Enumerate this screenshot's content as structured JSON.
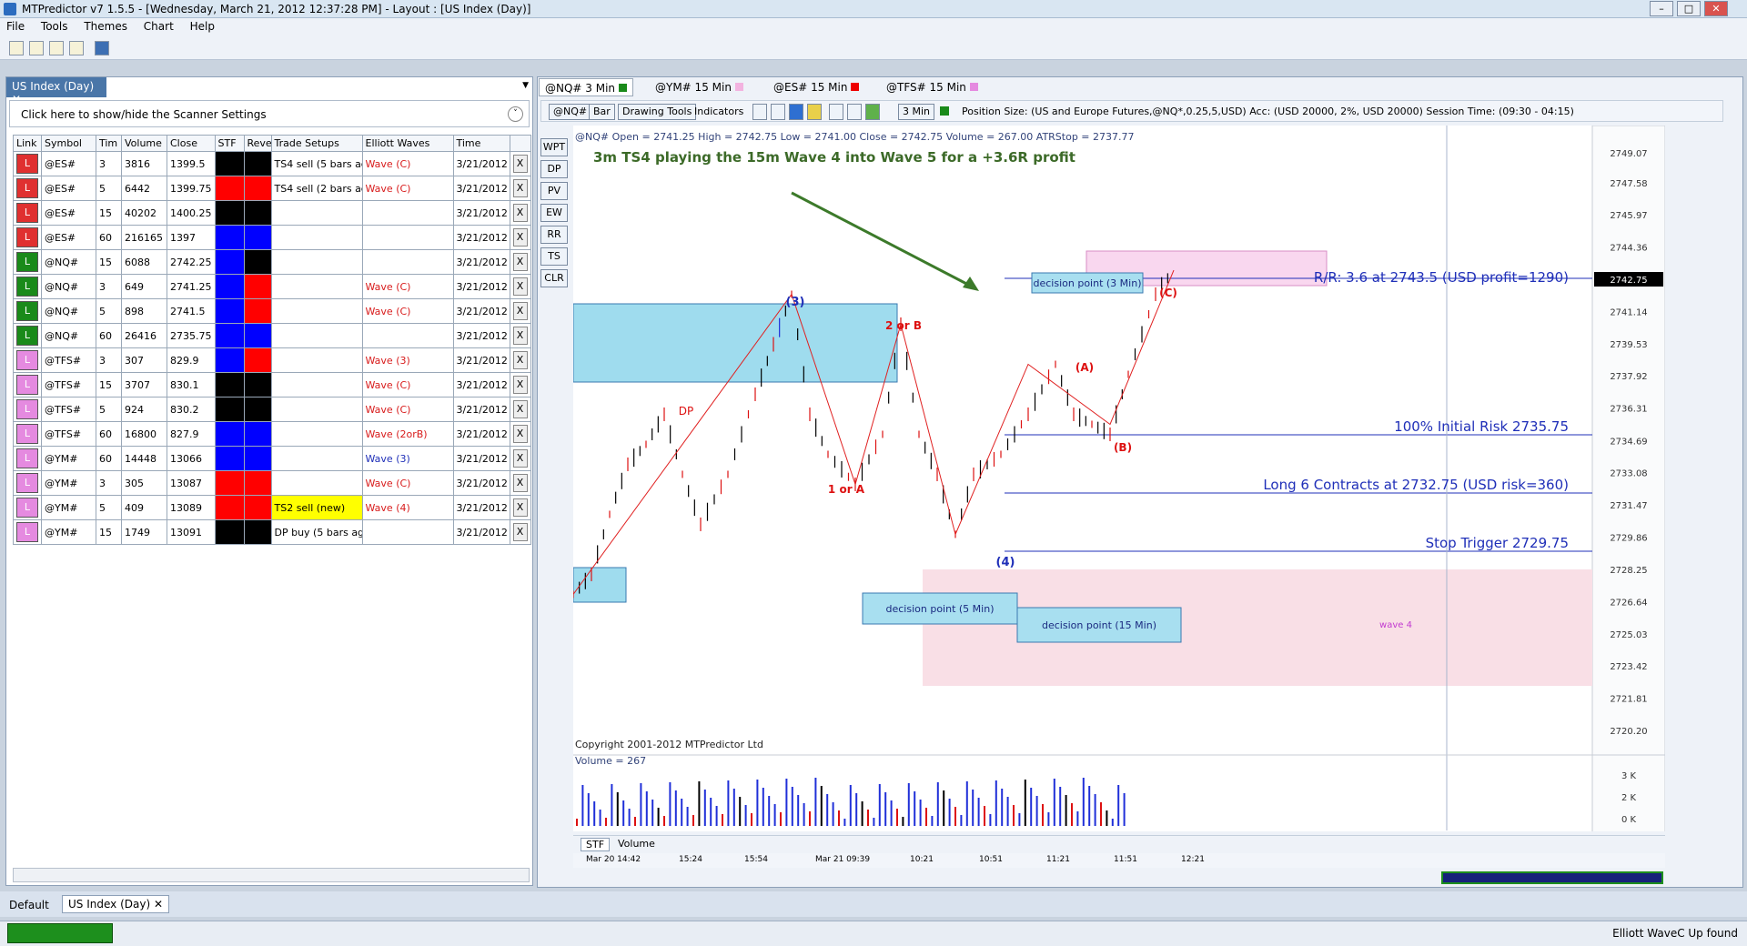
{
  "window": {
    "title": "MTPredictor v7 1.5.5 - [Wednesday, March 21, 2012 12:37:28 PM]  - Layout : [US Index (Day)]"
  },
  "menu": [
    "File",
    "Tools",
    "Themes",
    "Chart",
    "Help"
  ],
  "left": {
    "tab": "US Index (Day)",
    "scanner": "Click here to show/hide the Scanner Settings",
    "columns": [
      "Link",
      "Symbol",
      "Tim",
      "Volume",
      "Close",
      "STF",
      "Reve",
      "Trade Setups",
      "Elliott Waves",
      "Time"
    ],
    "rows": [
      {
        "link": "L",
        "lc": "#e03030",
        "sym": "@ES#",
        "tim": "3",
        "vol": "3816",
        "close": "1399.5",
        "stf": "#000",
        "rev": "#000",
        "setup": "TS4 sell (5 bars ag",
        "sc": "",
        "wave": "Wave (C)",
        "wc": "red",
        "time": "3/21/2012"
      },
      {
        "link": "L",
        "lc": "#e03030",
        "sym": "@ES#",
        "tim": "5",
        "vol": "6442",
        "close": "1399.75",
        "stf": "#ff0000",
        "rev": "#ff0000",
        "setup": "TS4 sell (2 bars ag",
        "sc": "",
        "wave": "Wave (C)",
        "wc": "red",
        "time": "3/21/2012"
      },
      {
        "link": "L",
        "lc": "#e03030",
        "sym": "@ES#",
        "tim": "15",
        "vol": "40202",
        "close": "1400.25",
        "stf": "#000",
        "rev": "#000",
        "setup": "",
        "sc": "",
        "wave": "",
        "wc": "red",
        "time": "3/21/2012"
      },
      {
        "link": "L",
        "lc": "#e03030",
        "sym": "@ES#",
        "tim": "60",
        "vol": "216165",
        "close": "1397",
        "stf": "#0000ff",
        "rev": "#0000ff",
        "setup": "",
        "sc": "",
        "wave": "",
        "wc": "red",
        "time": "3/21/2012"
      },
      {
        "link": "L",
        "lc": "#1a8a1a",
        "sym": "@NQ#",
        "tim": "15",
        "vol": "6088",
        "close": "2742.25",
        "stf": "#0000ff",
        "rev": "#000",
        "setup": "",
        "sc": "",
        "wave": "",
        "wc": "red",
        "time": "3/21/2012"
      },
      {
        "link": "L",
        "lc": "#1a8a1a",
        "sym": "@NQ#",
        "tim": "3",
        "vol": "649",
        "close": "2741.25",
        "stf": "#0000ff",
        "rev": "#ff0000",
        "setup": "",
        "sc": "",
        "wave": "Wave (C)",
        "wc": "red",
        "time": "3/21/2012"
      },
      {
        "link": "L",
        "lc": "#1a8a1a",
        "sym": "@NQ#",
        "tim": "5",
        "vol": "898",
        "close": "2741.5",
        "stf": "#0000ff",
        "rev": "#ff0000",
        "setup": "",
        "sc": "",
        "wave": "Wave (C)",
        "wc": "red",
        "time": "3/21/2012"
      },
      {
        "link": "L",
        "lc": "#1a8a1a",
        "sym": "@NQ#",
        "tim": "60",
        "vol": "26416",
        "close": "2735.75",
        "stf": "#0000ff",
        "rev": "#0000ff",
        "setup": "",
        "sc": "",
        "wave": "",
        "wc": "red",
        "time": "3/21/2012"
      },
      {
        "link": "L",
        "lc": "#e58ae0",
        "sym": "@TFS#",
        "tim": "3",
        "vol": "307",
        "close": "829.9",
        "stf": "#0000ff",
        "rev": "#ff0000",
        "setup": "",
        "sc": "",
        "wave": "Wave (3)",
        "wc": "red",
        "time": "3/21/2012"
      },
      {
        "link": "L",
        "lc": "#e58ae0",
        "sym": "@TFS#",
        "tim": "15",
        "vol": "3707",
        "close": "830.1",
        "stf": "#000",
        "rev": "#000",
        "setup": "",
        "sc": "",
        "wave": "Wave (C)",
        "wc": "red",
        "time": "3/21/2012"
      },
      {
        "link": "L",
        "lc": "#e58ae0",
        "sym": "@TFS#",
        "tim": "5",
        "vol": "924",
        "close": "830.2",
        "stf": "#000",
        "rev": "#000",
        "setup": "",
        "sc": "",
        "wave": "Wave (C)",
        "wc": "red",
        "time": "3/21/2012"
      },
      {
        "link": "L",
        "lc": "#e58ae0",
        "sym": "@TFS#",
        "tim": "60",
        "vol": "16800",
        "close": "827.9",
        "stf": "#0000ff",
        "rev": "#0000ff",
        "setup": "",
        "sc": "",
        "wave": "Wave (2orB)",
        "wc": "red",
        "time": "3/21/2012"
      },
      {
        "link": "L",
        "lc": "#e58ae0",
        "sym": "@YM#",
        "tim": "60",
        "vol": "14448",
        "close": "13066",
        "stf": "#0000ff",
        "rev": "#0000ff",
        "setup": "",
        "sc": "",
        "wave": "Wave (3)",
        "wc": "blu",
        "time": "3/21/2012"
      },
      {
        "link": "L",
        "lc": "#e58ae0",
        "sym": "@YM#",
        "tim": "3",
        "vol": "305",
        "close": "13087",
        "stf": "#ff0000",
        "rev": "#ff0000",
        "setup": "",
        "sc": "",
        "wave": "Wave (C)",
        "wc": "red",
        "time": "3/21/2012"
      },
      {
        "link": "L",
        "lc": "#e58ae0",
        "sym": "@YM#",
        "tim": "5",
        "vol": "409",
        "close": "13089",
        "stf": "#ff0000",
        "rev": "#ff0000",
        "setup": "TS2 sell (new)",
        "sc": "#ffff00",
        "wave": "Wave (4)",
        "wc": "red",
        "time": "3/21/2012"
      },
      {
        "link": "L",
        "lc": "#e58ae0",
        "sym": "@YM#",
        "tim": "15",
        "vol": "1749",
        "close": "13091",
        "stf": "#000",
        "rev": "#000",
        "setup": "DP buy (5 bars ag",
        "sc": "",
        "wave": "",
        "wc": "red",
        "time": "3/21/2012"
      }
    ]
  },
  "chart": {
    "tabs": [
      "@NQ# 3 Min",
      "@YM# 15 Min",
      "@ES# 15 Min",
      "@TFS# 15 Min"
    ],
    "toolbar": {
      "sym": "@NQ#",
      "bar": "Bar",
      "drawing": "Drawing Tools",
      "indicators": "Indicators",
      "interval": "3 Min",
      "position": "Position Size: (US and Europe Futures,@NQ*,0.25,5,USD) Acc: (USD 20000, 2%, USD 20000) Session Time: (09:30 - 04:15)"
    },
    "side_buttons": [
      "WPT",
      "DP",
      "PV",
      "EW",
      "RR",
      "TS",
      "CLR"
    ],
    "ohlc": "@NQ# Open = 2741.25  High = 2742.75  Low = 2741.00  Close = 2742.75  Volume = 267.00  ATRStop = 2737.77",
    "headline": "3m TS4 playing the 15m Wave 4 into Wave 5 for a +3.6R profit",
    "rr": "R/R: 3.6 at 2743.5 (USD profit=1290)",
    "risk": "100% Initial Risk 2735.75",
    "long": "Long 6 Contracts at 2732.75 (USD risk=360)",
    "stop": "Stop Trigger 2729.75",
    "dp3": "decision point (3 Min)",
    "dp5": "decision point (5 Min)",
    "dp15": "decision point (15 Min)",
    "labels": {
      "w3": "(3)",
      "w4": "(4)",
      "a": "(A)",
      "b": "(B)",
      "c": "(C)",
      "twob": "2 or B",
      "onea": "1 or A",
      "dp": "DP",
      "wave4": "wave 4"
    },
    "price_ticks": [
      "2749.07",
      "2747.58",
      "2745.97",
      "2744.36",
      "2742.75",
      "2741.14",
      "2739.53",
      "2737.92",
      "2736.31",
      "2734.69",
      "2733.08",
      "2731.47",
      "2729.86",
      "2728.25",
      "2726.64",
      "2725.03",
      "2723.42",
      "2721.81",
      "2720.20"
    ],
    "last_price": "2742.75",
    "copyright": "Copyright 2001-2012 MTPredictor Ltd",
    "volume_label": "Volume = 267",
    "vol_ticks": [
      "3 K",
      "2 K",
      "0 K"
    ],
    "time_ticks": [
      "Mar 20 14:42",
      "15:24",
      "15:54",
      "Mar 21 09:39",
      "10:21",
      "10:51",
      "11:21",
      "11:51",
      "12:21"
    ],
    "bottom_tabs": [
      "STF",
      "Volume"
    ]
  },
  "bottom": {
    "tabs": [
      "Default",
      "US Index (Day)"
    ]
  },
  "status": {
    "right": "Elliott WaveC Up found"
  },
  "colors": {
    "accent": "#4a76a8",
    "buy": "#0000ff",
    "sell": "#ff0000"
  }
}
